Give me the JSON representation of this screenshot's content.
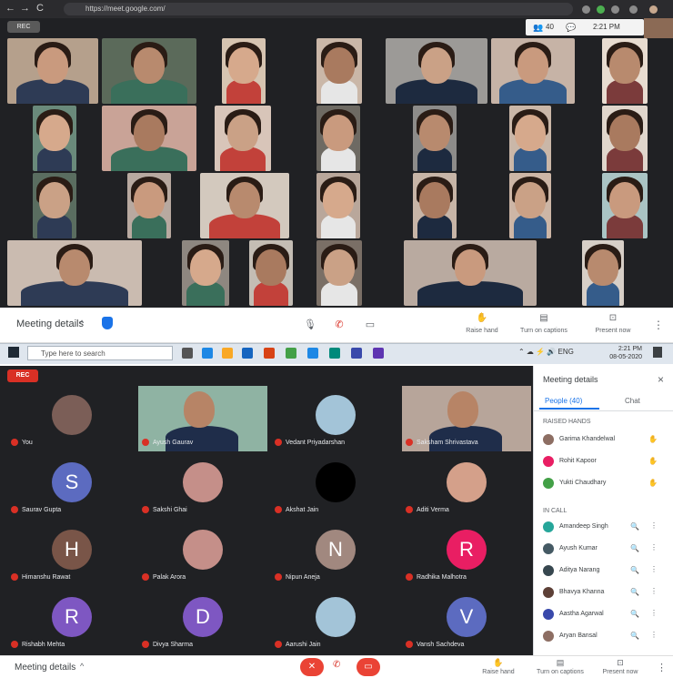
{
  "top": {
    "browser": {
      "url": "https://meet.google.com/",
      "back": "←",
      "forward": "→",
      "reload": "C"
    },
    "rec_badge": "REC",
    "top_right": {
      "count": "40",
      "time": "2:21 PM"
    },
    "bottom_bar": {
      "meeting_details": "Meeting details",
      "chevron": "^",
      "right": [
        {
          "label": "Raise hand"
        },
        {
          "label": "Turn on captions"
        },
        {
          "label": "Present now"
        }
      ],
      "more": "⋮"
    }
  },
  "taskbar": {
    "search_placeholder": "Type here to search",
    "clock_time": "2:21 PM",
    "clock_date": "08-05-2020"
  },
  "bottom": {
    "rec_badge": "REC",
    "tiles": [
      {
        "name": "You",
        "avatar": "photo"
      },
      {
        "name": "Ayush Gaurav",
        "avatar": "video"
      },
      {
        "name": "Vedant Priyadarshan",
        "avatar": "photo"
      },
      {
        "name": "Saksham Shrivastava",
        "avatar": "video"
      },
      {
        "name": "Saurav Gupta",
        "letter": "S",
        "color": "#5c6bc0"
      },
      {
        "name": "Sakshi Ghai",
        "avatar": "photo"
      },
      {
        "name": "Akshat Jain",
        "avatar": "black"
      },
      {
        "name": "Aditi Verma",
        "avatar": "photo"
      },
      {
        "name": "Himanshu Rawat",
        "letter": "H",
        "color": "#795548"
      },
      {
        "name": "Palak Arora",
        "avatar": "photo"
      },
      {
        "name": "Nipun Aneja",
        "letter": "N",
        "color": "#a1887f"
      },
      {
        "name": "Radhika Malhotra",
        "letter": "R",
        "color": "#e91e63"
      },
      {
        "name": "Rishabh Mehta",
        "letter": "R",
        "color": "#7e57c2"
      },
      {
        "name": "Divya Sharma",
        "letter": "D",
        "color": "#7e57c2"
      },
      {
        "name": "Aarushi Jain",
        "avatar": "photo"
      },
      {
        "name": "Vansh Sachdeva",
        "letter": "V",
        "color": "#5c6bc0"
      }
    ],
    "panel": {
      "title": "Meeting details",
      "tab_people": "People (40)",
      "tab_chat": "Chat",
      "section_hands": "RAISED HANDS",
      "hands": [
        {
          "name": "Garima Khandelwal",
          "color": "#8d6e63"
        },
        {
          "name": "Rohit Kapoor",
          "color": "#e91e63"
        },
        {
          "name": "Yukti Chaudhary",
          "color": "#43a047"
        }
      ],
      "section_list": "IN CALL",
      "people": [
        {
          "name": "Amandeep Singh",
          "color": "#26a69a"
        },
        {
          "name": "Ayush Kumar",
          "color": "#455a64"
        },
        {
          "name": "Aditya Narang",
          "color": "#37474f"
        },
        {
          "name": "Bhavya Khanna",
          "color": "#5d4037"
        },
        {
          "name": "Aastha Agarwal",
          "color": "#3949ab"
        },
        {
          "name": "Aryan Bansal",
          "color": "#8d6e63"
        }
      ]
    },
    "bottom_bar": {
      "meeting_details": "Meeting details",
      "right": [
        {
          "label": "Raise hand"
        },
        {
          "label": "Turn on captions"
        },
        {
          "label": "Present now"
        }
      ]
    }
  }
}
